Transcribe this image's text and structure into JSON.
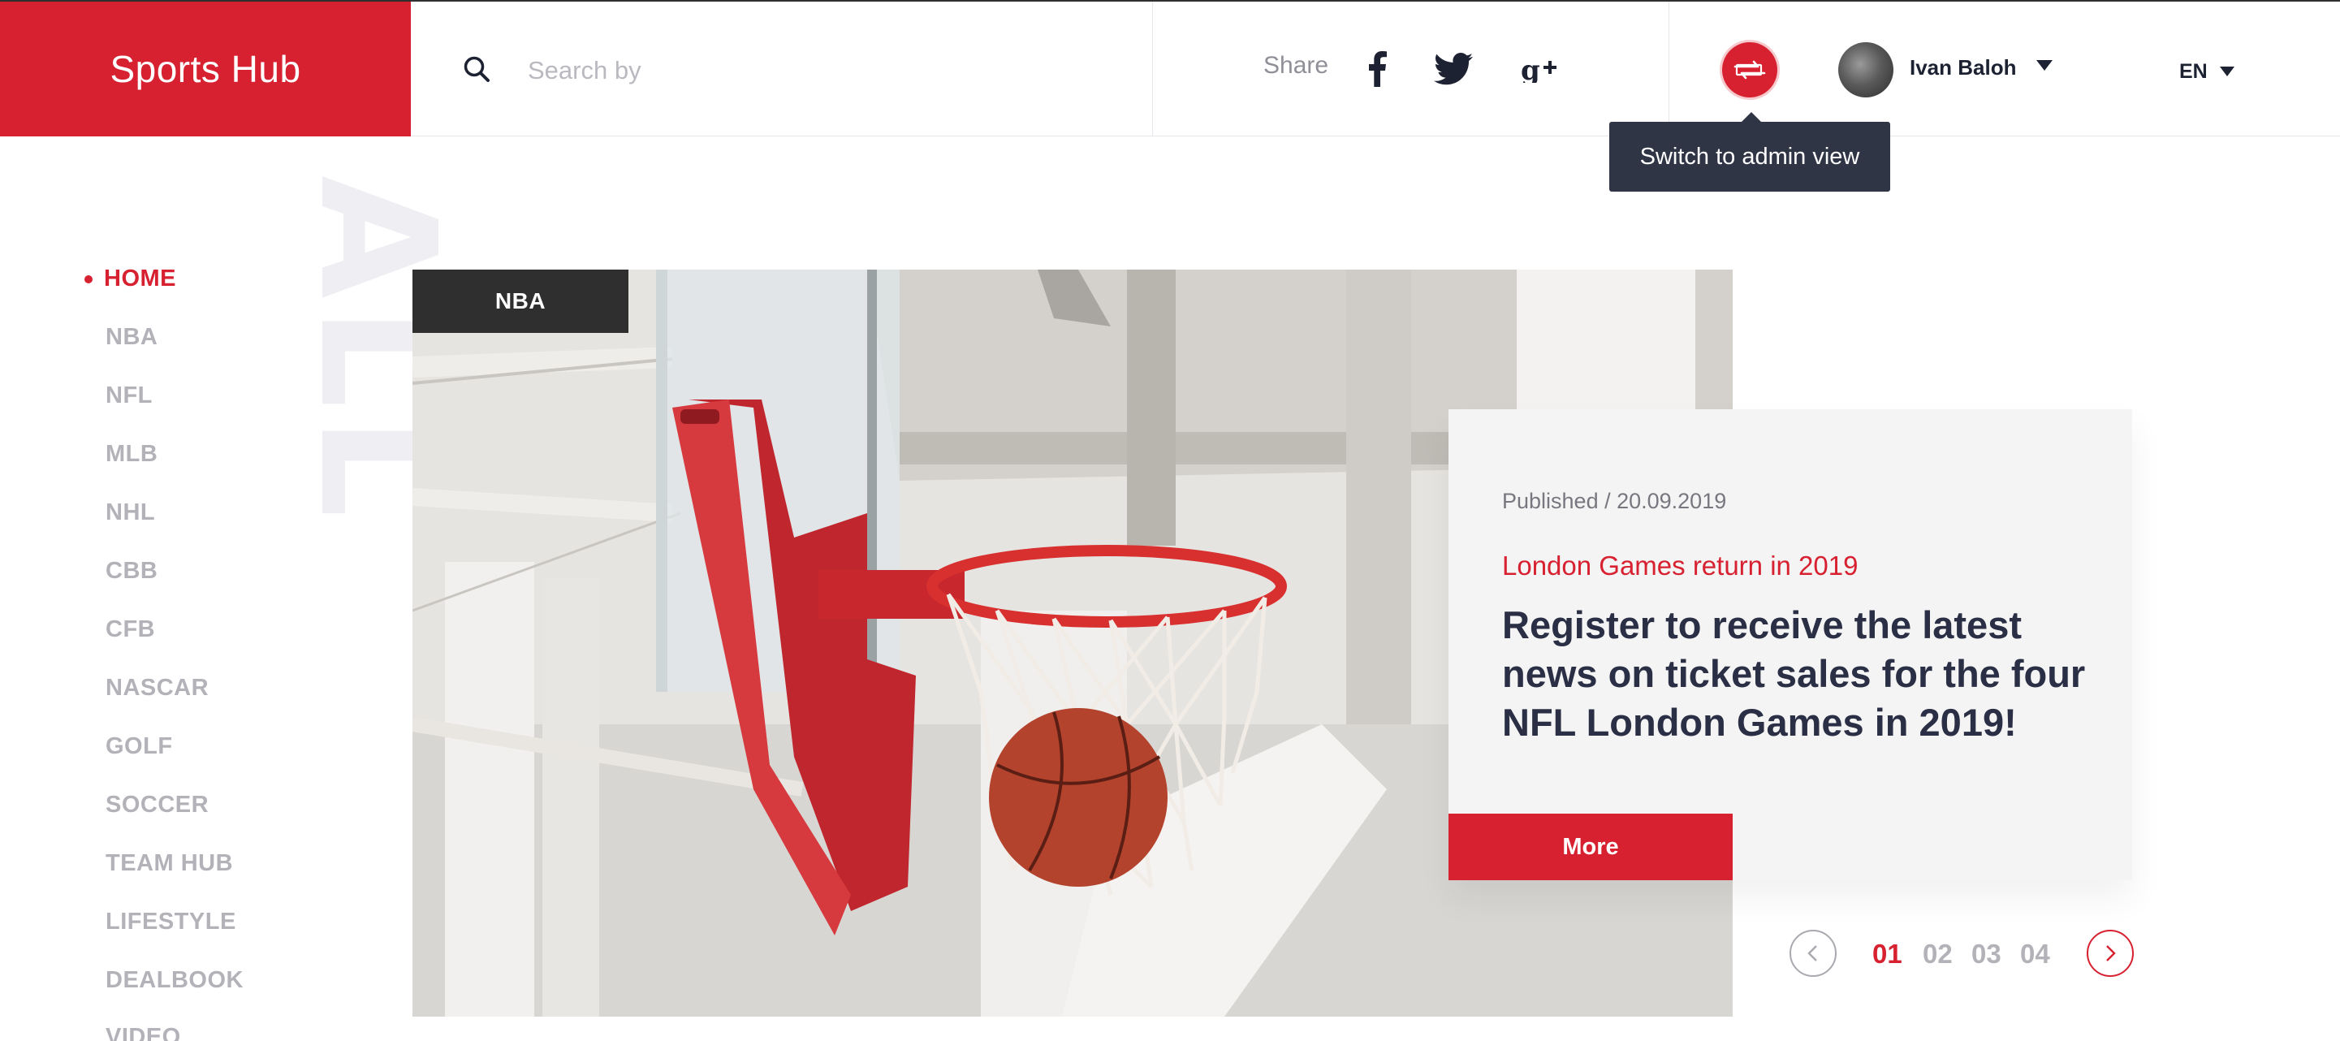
{
  "header": {
    "logo": "Sports Hub",
    "search": {
      "placeholder": "Search by",
      "value": ""
    },
    "share_label": "Share",
    "social": [
      "facebook-icon",
      "twitter-icon",
      "google-plus-icon"
    ],
    "admin_tooltip": "Switch to admin view",
    "user": {
      "name": "Ivan Baloh"
    },
    "language": "EN"
  },
  "nav": {
    "watermark": "ALL",
    "items": [
      {
        "label": "HOME",
        "active": true
      },
      {
        "label": "NBA"
      },
      {
        "label": "NFL"
      },
      {
        "label": "MLB"
      },
      {
        "label": "NHL"
      },
      {
        "label": "CBB"
      },
      {
        "label": "CFB"
      },
      {
        "label": "NASCAR"
      },
      {
        "label": "GOLF"
      },
      {
        "label": "SOCCER"
      },
      {
        "label": "TEAM HUB"
      },
      {
        "label": "LIFESTYLE"
      },
      {
        "label": "DEALBOOK"
      },
      {
        "label": "VIDEO"
      }
    ]
  },
  "hero": {
    "tag": "NBA",
    "published": "Published / 20.09.2019",
    "subtitle": "London Games return in 2019",
    "title": "Register to receive the latest news on ticket sales for the four NFL London Games in 2019!",
    "more_label": "More"
  },
  "pager": {
    "pages": [
      "01",
      "02",
      "03",
      "04"
    ],
    "current": "01"
  },
  "colors": {
    "accent": "#d72130",
    "dark": "#2f2f2f",
    "tooltip": "#2f3545",
    "muted": "#b2b2b8"
  }
}
